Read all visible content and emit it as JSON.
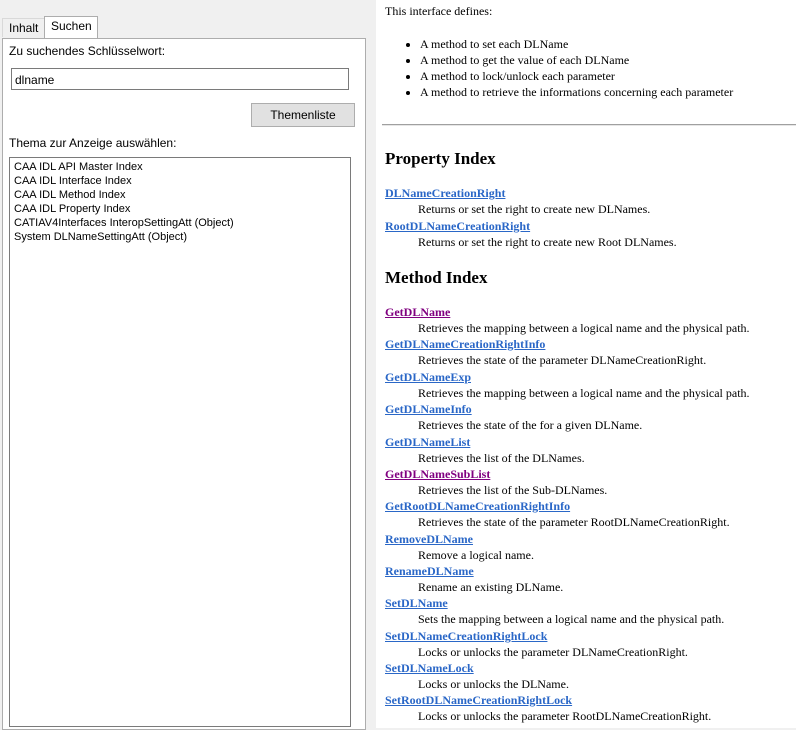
{
  "left": {
    "tabs": [
      "Inhalt",
      "Suchen"
    ],
    "keyword_label": "Zu suchendes Schlüsselwort:",
    "keyword_value": "dlname",
    "topics_button": "Themenliste",
    "select_label": "Thema zur Anzeige auswählen:",
    "results": [
      "CAA IDL API Master Index",
      "CAA IDL Interface Index",
      "CAA IDL Method Index",
      "CAA IDL Property Index",
      "CATIAV4Interfaces InteropSettingAtt (Object)",
      "System DLNameSettingAtt (Object)"
    ]
  },
  "right": {
    "intro": "This interface defines:",
    "bullets": [
      "A method to set each DLName",
      "A method to get the value of each DLName",
      "A method to lock/unlock each parameter",
      "A method to retrieve the informations concerning each parameter"
    ],
    "property_title": "Property Index",
    "properties": [
      {
        "name": "DLNameCreationRight",
        "desc": "Returns or set the right to create new DLNames."
      },
      {
        "name": "RootDLNameCreationRight",
        "desc": "Returns or set the right to create new Root DLNames."
      }
    ],
    "method_title": "Method Index",
    "methods": [
      {
        "name": "GetDLName",
        "desc": "Retrieves the mapping between a logical name and the physical path."
      },
      {
        "name": "GetDLNameCreationRightInfo",
        "desc": "Retrieves the state of the parameter DLNameCreationRight."
      },
      {
        "name": "GetDLNameExp",
        "desc": "Retrieves the mapping between a logical name and the physical path."
      },
      {
        "name": "GetDLNameInfo",
        "desc": "Retrieves the state of the for a given DLName."
      },
      {
        "name": "GetDLNameList",
        "desc": "Retrieves the list of the DLNames."
      },
      {
        "name": "GetDLNameSubList",
        "desc": "Retrieves the list of the Sub-DLNames."
      },
      {
        "name": "GetRootDLNameCreationRightInfo",
        "desc": "Retrieves the state of the parameter RootDLNameCreationRight."
      },
      {
        "name": "RemoveDLName",
        "desc": "Remove a logical name."
      },
      {
        "name": "RenameDLName",
        "desc": "Rename an existing DLName."
      },
      {
        "name": "SetDLName",
        "desc": "Sets the mapping between a logical name and the physical path."
      },
      {
        "name": "SetDLNameCreationRightLock",
        "desc": "Locks or unlocks the parameter DLNameCreationRight."
      },
      {
        "name": "SetDLNameLock",
        "desc": "Locks or unlocks the DLName."
      },
      {
        "name": "SetRootDLNameCreationRightLock",
        "desc": "Locks or unlocks the parameter RootDLNameCreationRight."
      }
    ]
  }
}
